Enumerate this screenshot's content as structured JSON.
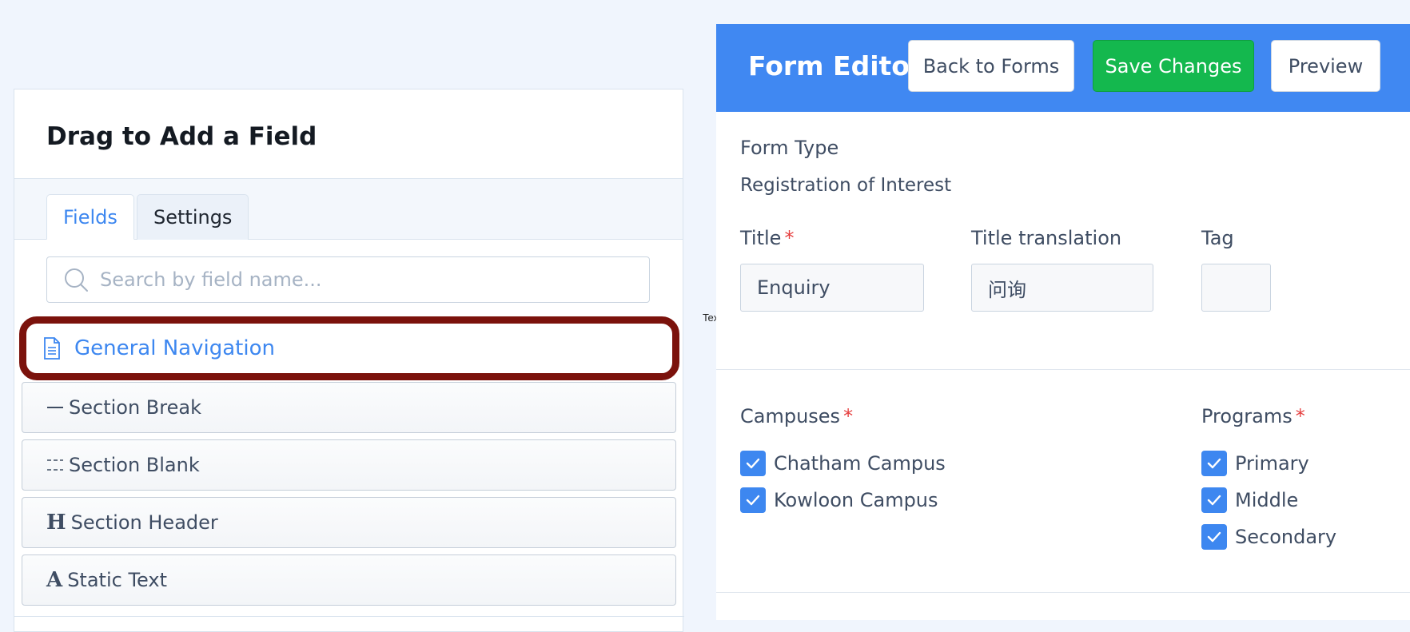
{
  "library": {
    "title": "Drag to Add a Field",
    "tabs": [
      {
        "label": "Fields",
        "active": true
      },
      {
        "label": "Settings",
        "active": false
      }
    ],
    "search": {
      "placeholder": "Search by field name...",
      "value": ""
    },
    "highlighted_item": {
      "label": "General Navigation",
      "icon": "document-icon"
    },
    "items": [
      {
        "label": "Section Break",
        "icon": "dash-icon"
      },
      {
        "label": "Section Blank",
        "icon": "dashed-lines-icon"
      },
      {
        "label": "Section Header",
        "icon": "header-h-icon"
      },
      {
        "label": "Static Text",
        "icon": "text-a-icon"
      }
    ]
  },
  "stray_text": "Text",
  "editor": {
    "title": "Form Editor",
    "buttons": {
      "back": "Back to Forms",
      "save": "Save Changes",
      "preview": "Preview"
    },
    "form_type_label": "Form Type",
    "form_type_value": "Registration of Interest",
    "title_label": "Title",
    "title_value": "Enquiry",
    "translation_label": "Title translation",
    "translation_value": "问询",
    "tag_label": "Tag",
    "tag_value": "",
    "required_mark": "*",
    "campuses": {
      "label": "Campuses",
      "options": [
        {
          "label": "Chatham Campus",
          "checked": true
        },
        {
          "label": "Kowloon Campus",
          "checked": true
        }
      ]
    },
    "programs": {
      "label": "Programs",
      "options": [
        {
          "label": "Primary",
          "checked": true
        },
        {
          "label": "Middle",
          "checked": true
        },
        {
          "label": "Secondary",
          "checked": true
        }
      ]
    }
  },
  "colors": {
    "accent": "#4088f2",
    "save": "#14b84e",
    "highlight_border": "#7b120c",
    "required": "#e53e3e"
  }
}
